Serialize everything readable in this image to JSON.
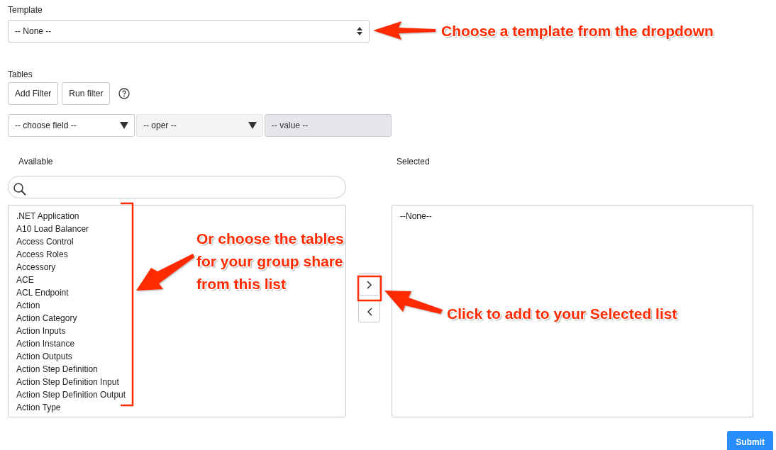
{
  "template": {
    "label": "Template",
    "value": "-- None --"
  },
  "tables": {
    "label": "Tables",
    "buttons": [
      "Add Filter",
      "Run filter"
    ]
  },
  "filter": {
    "field": "-- choose field --",
    "oper": "-- oper --",
    "value": {
      "placeholder": "-- value --",
      "disabled": true
    }
  },
  "available": {
    "label": "Available",
    "items": [
      ".NET Application",
      "A10 Load Balancer",
      "Access Control",
      "Access Roles",
      "Accessory",
      "ACE",
      "ACL Endpoint",
      "Action",
      "Action Category",
      "Action Inputs",
      "Action Instance",
      "Action Outputs",
      "Action Step Definition",
      "Action Step Definition Input",
      "Action Step Definition Output",
      "Action Type"
    ]
  },
  "selected": {
    "label": "Selected",
    "items": [
      "--None--"
    ]
  },
  "submit": "Submit",
  "annotations": [
    {
      "text": "Choose a template from the dropdown"
    },
    {
      "text": "Or choose the tables for your group share from this list"
    },
    {
      "text": "Click to add to your Selected list"
    }
  ]
}
